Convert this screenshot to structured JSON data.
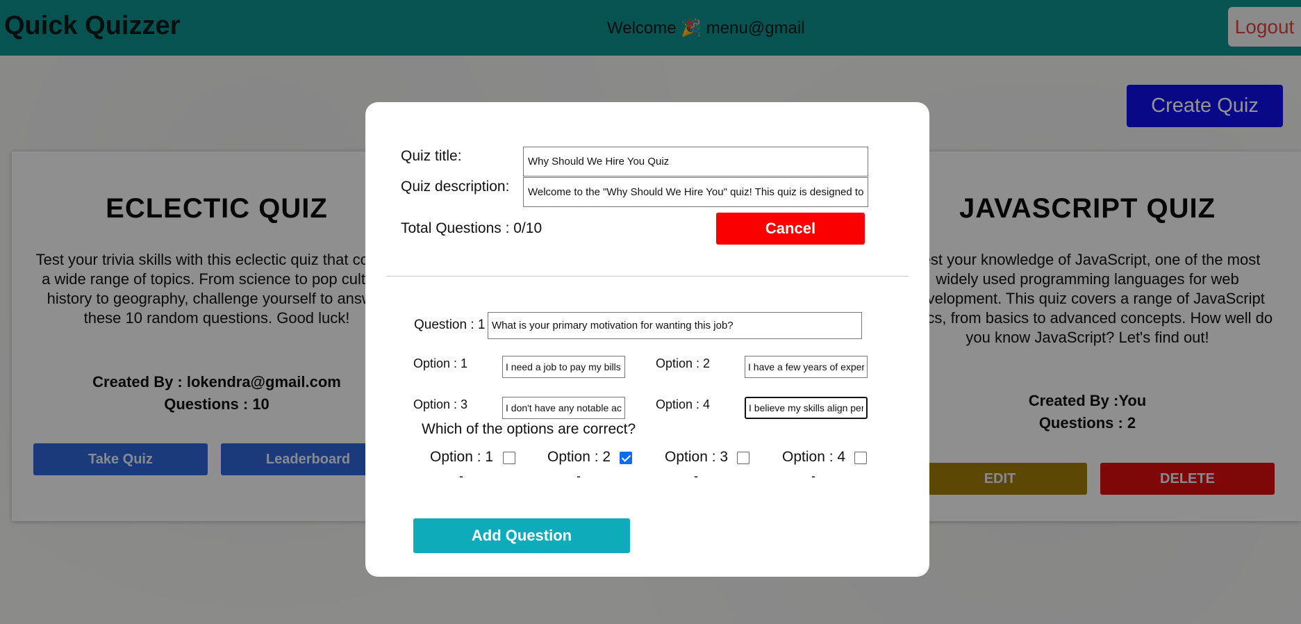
{
  "header": {
    "brand": "Quick Quizzer",
    "welcome": "Welcome 🎉 menu@gmail",
    "logout_label": "Logout"
  },
  "actions": {
    "create_quiz_label": "Create Quiz"
  },
  "quizzes": [
    {
      "title": "ECLECTIC QUIZ",
      "description": "Test your trivia skills with this eclectic quiz that covers a wide range of topics. From science to pop culture, history to geography, challenge yourself to answer these 10 random questions. Good luck!",
      "created_by": "Created By : lokendra@gmail.com",
      "questions": "Questions : 10",
      "buttons": [
        "Take Quiz",
        "Leaderboard"
      ]
    },
    {
      "title": "JAVASCRIPT QUIZ",
      "description": "Test your knowledge of JavaScript, one of the most widely used programming languages for web development. This quiz covers a range of JavaScript topics, from basics to advanced concepts. How well do you know JavaScript? Let's find out!",
      "created_by": "Created By :You",
      "questions": "Questions : 2",
      "buttons": [
        "EDIT",
        "DELETE"
      ]
    }
  ],
  "modal": {
    "title_label": "Quiz title:",
    "title_value": "Why Should We Hire You Quiz",
    "description_label": "Quiz description:",
    "description_value": "Welcome to the \"Why Should We Hire You\" quiz! This quiz is designed to",
    "total_questions": "Total Questions : 0/10",
    "cancel_label": "Cancel",
    "question_label": "Question : 1",
    "question_value": "What is your primary motivation for wanting this job?",
    "options": [
      {
        "label": "Option : 1",
        "value": "I need a job to pay my bills"
      },
      {
        "label": "Option : 2",
        "value": "I have a few years of experience"
      },
      {
        "label": "Option : 3",
        "value": "I don't have any notable achievements"
      },
      {
        "label": "Option : 4",
        "value": "I believe my skills align perfectly"
      }
    ],
    "correct_prompt": "Which of the options are correct?",
    "correct_options": [
      {
        "label": "Option : 1",
        "checked": false,
        "dash": "-"
      },
      {
        "label": "Option : 2",
        "checked": true,
        "dash": "-"
      },
      {
        "label": "Option : 3",
        "checked": false,
        "dash": "-"
      },
      {
        "label": "Option : 4",
        "checked": false,
        "dash": "-"
      }
    ],
    "add_question_label": "Add Question"
  },
  "colors": {
    "header": "#0b8f8c",
    "create_quiz": "#1010e8",
    "take_quiz": "#2e64d6",
    "edit": "#a07a0a",
    "delete": "#d90f0f",
    "cancel": "#fb0000",
    "add_question": "#0eacba"
  }
}
